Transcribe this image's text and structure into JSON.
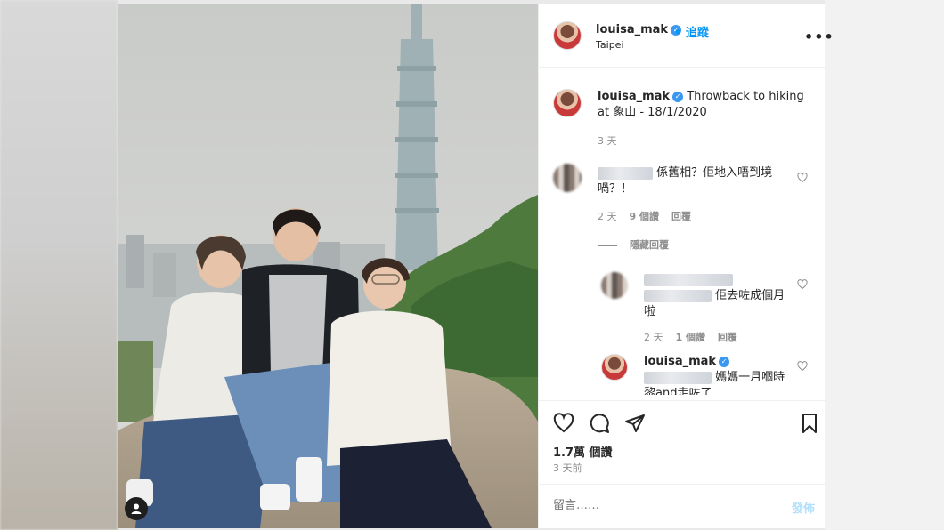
{
  "post": {
    "username": "louisa_mak",
    "follow_label": "追蹤",
    "location": "Taipei",
    "more_label": "•••",
    "caption_username": "louisa_mak",
    "caption_text": "Throwback to hiking at 象山 - 18/1/2020",
    "caption_time": "3 天",
    "likes": "1.7萬 個讚",
    "posted": "3 天前",
    "comment_placeholder": "留言……",
    "post_label": "發佈"
  },
  "comments": [
    {
      "text": "係舊相？佢地入唔到境喎？！",
      "time": "2 天",
      "likes": "9 個讚",
      "reply": "回覆",
      "hide_replies": "隱藏回覆"
    }
  ],
  "replies": [
    {
      "text": "佢去咗成個月啦",
      "time": "2 天",
      "likes": "1 個讚",
      "reply": "回覆"
    },
    {
      "username": "louisa_mak",
      "text": "媽媽一月嗰時黎and走咗了"
    }
  ],
  "colors": {
    "accent": "#0095f6",
    "verified": "#3897f0",
    "muted": "#8e8e8e"
  },
  "icons": [
    "heart-icon",
    "comment-icon",
    "share-icon",
    "bookmark-icon",
    "verified-icon",
    "more-icon",
    "user-tag-icon"
  ]
}
